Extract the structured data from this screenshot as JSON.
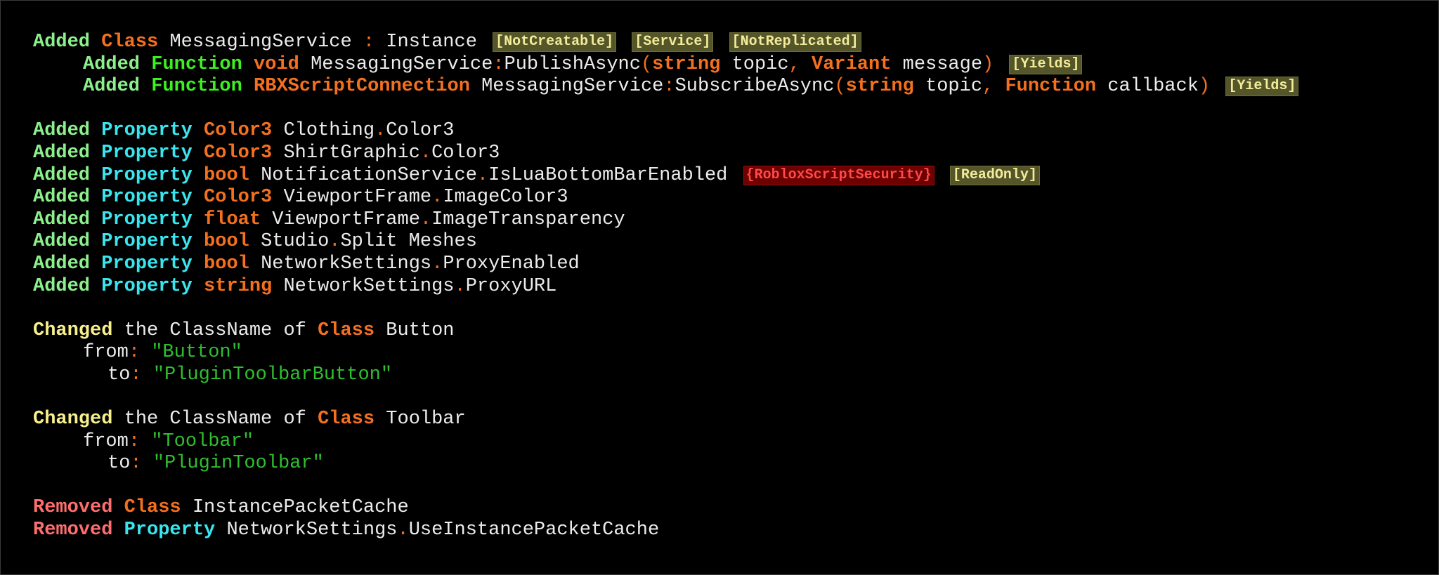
{
  "words": {
    "added": "Added",
    "changed": "Changed",
    "removed": "Removed",
    "class": "Class",
    "function": "Function",
    "property": "Property",
    "the_classname_of": "the ClassName of",
    "from": "from",
    "to": "to"
  },
  "class_added": {
    "name": "MessagingService",
    "superclass": "Instance",
    "tags": [
      "[NotCreatable]",
      "[Service]",
      "[NotReplicated]"
    ]
  },
  "functions": [
    {
      "return_type": "void",
      "owner": "MessagingService",
      "name": "PublishAsync",
      "params": [
        {
          "type": "string",
          "name": "topic"
        },
        {
          "type": "Variant",
          "name": "message"
        }
      ],
      "tag": "[Yields]"
    },
    {
      "return_type": "RBXScriptConnection",
      "owner": "MessagingService",
      "name": "SubscribeAsync",
      "params": [
        {
          "type": "string",
          "name": "topic"
        },
        {
          "type": "Function",
          "name": "callback"
        }
      ],
      "tag": "[Yields]"
    }
  ],
  "properties_added": [
    {
      "type": "Color3",
      "owner": "Clothing",
      "name": "Color3"
    },
    {
      "type": "Color3",
      "owner": "ShirtGraphic",
      "name": "Color3"
    },
    {
      "type": "bool",
      "owner": "NotificationService",
      "name": "IsLuaBottomBarEnabled",
      "security_tag": "{RobloxScriptSecurity}",
      "tag": "[ReadOnly]"
    },
    {
      "type": "Color3",
      "owner": "ViewportFrame",
      "name": "ImageColor3"
    },
    {
      "type": "float",
      "owner": "ViewportFrame",
      "name": "ImageTransparency"
    },
    {
      "type": "bool",
      "owner": "Studio",
      "name": "Split Meshes"
    },
    {
      "type": "bool",
      "owner": "NetworkSettings",
      "name": "ProxyEnabled"
    },
    {
      "type": "string",
      "owner": "NetworkSettings",
      "name": "ProxyURL"
    }
  ],
  "classname_changes": [
    {
      "class": "Button",
      "from": "\"Button\"",
      "to": "\"PluginToolbarButton\""
    },
    {
      "class": "Toolbar",
      "from": "\"Toolbar\"",
      "to": "\"PluginToolbar\""
    }
  ],
  "removed": {
    "class": "InstancePacketCache",
    "property_owner": "NetworkSettings",
    "property_name": "UseInstancePacketCache"
  }
}
